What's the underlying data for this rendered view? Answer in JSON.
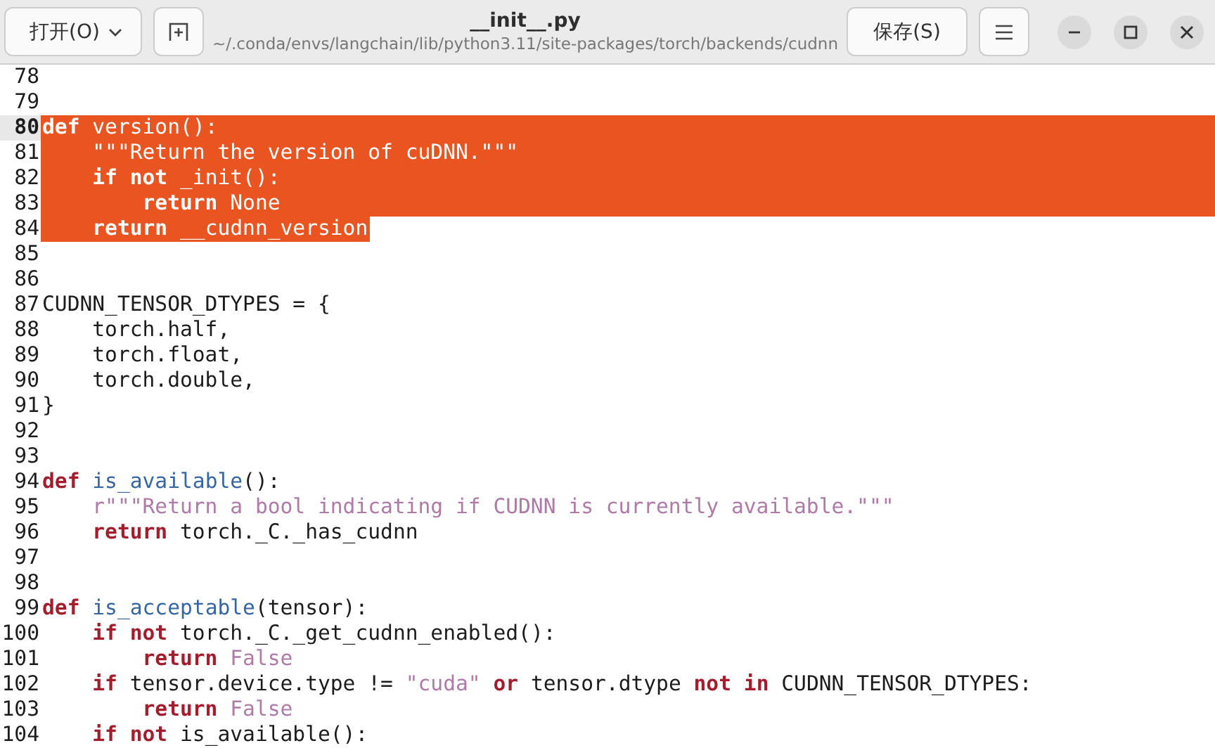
{
  "header": {
    "open_button": "打开(O)",
    "title": "__init__.py",
    "path": "~/.conda/envs/langchain/lib/python3.11/site-packages/torch/backends/cudnn",
    "save_button": "保存(S)"
  },
  "editor": {
    "lines": [
      {
        "number": "78",
        "current": false,
        "selected": false
      },
      {
        "number": "79",
        "current": false,
        "selected": false
      },
      {
        "number": "80",
        "current": true,
        "selected": true,
        "tokens": [
          {
            "kind": "keyword",
            "text": "def"
          },
          {
            "kind": "function",
            "text": " version"
          },
          {
            "kind": "plain",
            "text": "():"
          }
        ]
      },
      {
        "number": "81",
        "current": false,
        "selected": true,
        "tokens": [
          {
            "kind": "string",
            "text": "    \"\"\"Return the version of cuDNN.\"\"\""
          }
        ]
      },
      {
        "number": "82",
        "current": false,
        "selected": true,
        "tokens": [
          {
            "kind": "keyword",
            "text": "    if"
          },
          {
            "kind": "keyword",
            "text": " not"
          },
          {
            "kind": "plain",
            "text": " _init():"
          }
        ]
      },
      {
        "number": "83",
        "current": false,
        "selected": true,
        "tokens": [
          {
            "kind": "keyword",
            "text": "        return"
          },
          {
            "kind": "constant",
            "text": " None"
          }
        ]
      },
      {
        "number": "84",
        "current": false,
        "selected": true,
        "tokens": [
          {
            "kind": "keyword",
            "text": "    return"
          },
          {
            "kind": "plain",
            "text": " __cudnn_version"
          }
        ]
      },
      {
        "number": "85",
        "current": false,
        "selected": false
      },
      {
        "number": "86",
        "current": false,
        "selected": false
      },
      {
        "number": "87",
        "current": false,
        "selected": false,
        "tokens": [
          {
            "kind": "plain",
            "text": "CUDNN_TENSOR_DTYPES = {"
          }
        ]
      },
      {
        "number": "88",
        "current": false,
        "selected": false,
        "tokens": [
          {
            "kind": "plain",
            "text": "    torch.half,"
          }
        ]
      },
      {
        "number": "89",
        "current": false,
        "selected": false,
        "tokens": [
          {
            "kind": "plain",
            "text": "    torch.float,"
          }
        ]
      },
      {
        "number": "90",
        "current": false,
        "selected": false,
        "tokens": [
          {
            "kind": "plain",
            "text": "    torch.double,"
          }
        ]
      },
      {
        "number": "91",
        "current": false,
        "selected": false,
        "tokens": [
          {
            "kind": "plain",
            "text": "}"
          }
        ]
      },
      {
        "number": "92",
        "current": false,
        "selected": false
      },
      {
        "number": "93",
        "current": false,
        "selected": false
      },
      {
        "number": "94",
        "current": false,
        "selected": false,
        "tokens": [
          {
            "kind": "keyword",
            "text": "def"
          },
          {
            "kind": "function",
            "text": " is_available"
          },
          {
            "kind": "plain",
            "text": "():"
          }
        ]
      },
      {
        "number": "95",
        "current": false,
        "selected": false,
        "tokens": [
          {
            "kind": "string",
            "text": "    r\"\"\"Return a bool indicating if CUDNN is currently available.\"\"\""
          }
        ]
      },
      {
        "number": "96",
        "current": false,
        "selected": false,
        "tokens": [
          {
            "kind": "keyword",
            "text": "    return"
          },
          {
            "kind": "plain",
            "text": " torch._C._has_cudnn"
          }
        ]
      },
      {
        "number": "97",
        "current": false,
        "selected": false
      },
      {
        "number": "98",
        "current": false,
        "selected": false
      },
      {
        "number": "99",
        "current": false,
        "selected": false,
        "tokens": [
          {
            "kind": "keyword",
            "text": "def"
          },
          {
            "kind": "function",
            "text": " is_acceptable"
          },
          {
            "kind": "plain",
            "text": "(tensor):"
          }
        ]
      },
      {
        "number": "100",
        "current": false,
        "selected": false,
        "tokens": [
          {
            "kind": "keyword",
            "text": "    if"
          },
          {
            "kind": "keyword",
            "text": " not"
          },
          {
            "kind": "plain",
            "text": " torch._C._get_cudnn_enabled():"
          }
        ]
      },
      {
        "number": "101",
        "current": false,
        "selected": false,
        "tokens": [
          {
            "kind": "keyword",
            "text": "        return"
          },
          {
            "kind": "constant",
            "text": " False"
          }
        ]
      },
      {
        "number": "102",
        "current": false,
        "selected": false,
        "tokens": [
          {
            "kind": "keyword",
            "text": "    if"
          },
          {
            "kind": "plain",
            "text": " tensor.device.type !="
          },
          {
            "kind": "string",
            "text": " \"cuda\""
          },
          {
            "kind": "keyword",
            "text": " or"
          },
          {
            "kind": "plain",
            "text": " tensor.dtype"
          },
          {
            "kind": "keyword",
            "text": " not"
          },
          {
            "kind": "keyword",
            "text": " in"
          },
          {
            "kind": "plain",
            "text": " CUDNN_TENSOR_DTYPES:"
          }
        ]
      },
      {
        "number": "103",
        "current": false,
        "selected": false,
        "tokens": [
          {
            "kind": "keyword",
            "text": "        return"
          },
          {
            "kind": "constant",
            "text": " False"
          }
        ]
      },
      {
        "number": "104",
        "current": false,
        "selected": false,
        "tokens": [
          {
            "kind": "keyword",
            "text": "    if"
          },
          {
            "kind": "keyword",
            "text": " not"
          },
          {
            "kind": "plain",
            "text": " is_available():"
          }
        ]
      }
    ]
  }
}
